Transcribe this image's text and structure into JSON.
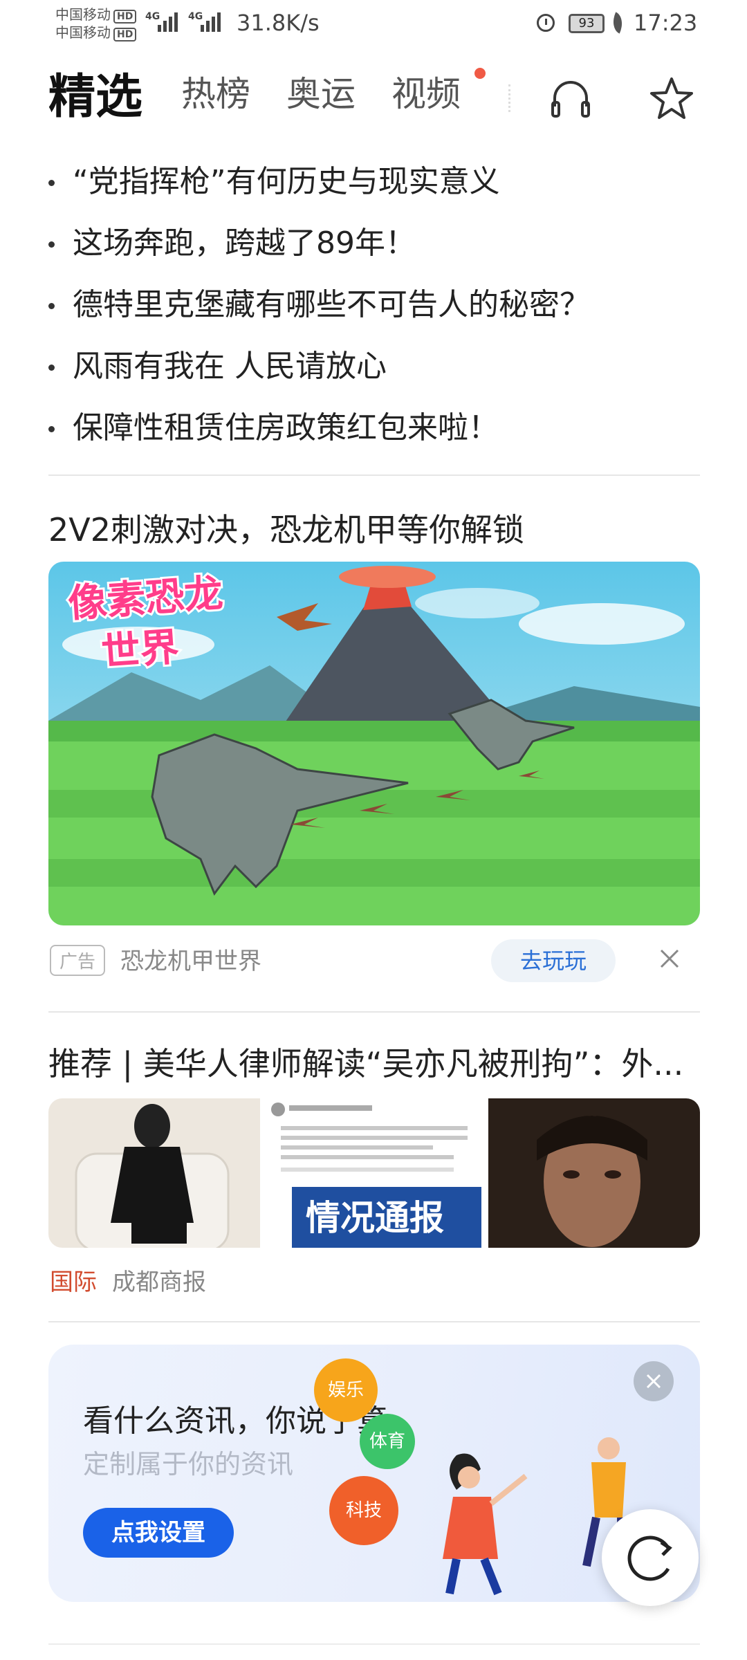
{
  "status_bar": {
    "carrier_1": "中国移动",
    "carrier_2": "中国移动",
    "hd": "HD",
    "network": "4G",
    "speed": "31.8K/s",
    "battery": "93",
    "time": "17:23"
  },
  "nav": {
    "tabs": [
      {
        "label": "精选",
        "active": true
      },
      {
        "label": "热榜"
      },
      {
        "label": "奥运"
      },
      {
        "label": "视频",
        "badge": true
      }
    ],
    "icons": [
      "headphone-icon",
      "star-icon"
    ]
  },
  "headlines": [
    "“党指挥枪”有何历史与现实意义",
    "这场奔跑，跨越了89年！",
    "德特里克堡藏有哪些不可告人的秘密？",
    "风雨有我在 人民请放心",
    "保障性租赁住房政策红包来啦！"
  ],
  "ad": {
    "title": "2V2刺激对决，恐龙机甲等你解锁",
    "image_text_1": "像素恐龙",
    "image_text_2": "世界",
    "tag": "广告",
    "source": "恐龙机甲世界",
    "cta": "去玩玩"
  },
  "news": {
    "title": "推荐 | 美华人律师解读“吴亦凡被刑拘”：外...",
    "thumb_text": "情况通报",
    "category": "国际",
    "source": "成都商报"
  },
  "card": {
    "title": "看什么资讯，你说了算",
    "subtitle": "定制属于你的资讯",
    "button": "点我设置",
    "bubbles": [
      "娱乐",
      "体育",
      "科技"
    ]
  },
  "colors": {
    "accent_blue": "#1a62e8",
    "category_red": "#d24c2f",
    "badge_red": "#f05a45"
  }
}
